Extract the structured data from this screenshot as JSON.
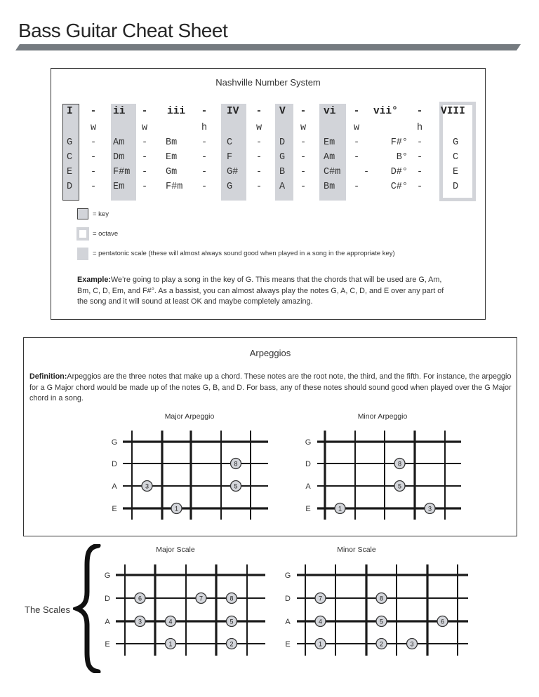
{
  "header": {
    "title": "Bass Guitar Cheat Sheet",
    "bar_color": "#757b80"
  },
  "nashville": {
    "title": "Nashville Number System",
    "numerals": [
      "I",
      "ii",
      "iii",
      "IV",
      "V",
      "vi",
      "vii°",
      "VIII"
    ],
    "separator": "-",
    "steps": [
      "w",
      "w",
      "h",
      "w",
      "w",
      "w",
      "h"
    ],
    "keys": [
      {
        "chords": [
          "G",
          "Am",
          "Bm",
          "C",
          "D",
          "Em",
          "F#°",
          "G"
        ]
      },
      {
        "chords": [
          "C",
          "Dm",
          "Em",
          "F",
          "G",
          "Am",
          "B°",
          "C"
        ]
      },
      {
        "chords": [
          "E",
          "F#m",
          "Gm",
          "G#",
          "B",
          "C#m",
          "D#°",
          "E"
        ]
      },
      {
        "chords": [
          "D",
          "Em",
          "F#m",
          "G",
          "A",
          "Bm",
          "C#°",
          "D"
        ]
      }
    ],
    "key_column": "I",
    "octave_column": "VIII",
    "pentatonic_columns": [
      "I",
      "ii",
      "IV",
      "V",
      "vi"
    ],
    "legend": [
      {
        "type": "key",
        "label": "= key"
      },
      {
        "type": "octave",
        "label": "= octave"
      },
      {
        "type": "pentatonic",
        "label": "= pentatonic scale (these will almost always sound good when played in a song in the appropriate key)"
      }
    ],
    "example_label": "Example:",
    "example_text": "We’re going to play a song in the key of G.  This means that the chords that will be used are G, Am, Bm, C, D, Em, and F#°.  As a bassist, you can almost always play the notes G, A, C, D, and E over any part of the song and it will sound at least OK and maybe completely amazing.",
    "highlight_color": "#d2d4d9"
  },
  "arpeggios": {
    "title": "Arpeggios",
    "definition_label": "Definition:",
    "definition_text": "Arpeggios are the three notes that make up a chord.  These notes are the root note, the third, and the fifth. For instance, the arpeggio for a G Major chord would be made up of the notes G, B, and D.  For bass, any of these notes should sound good when played over the G Major chord in a song.",
    "diagrams": [
      {
        "title": "Major Arpeggio",
        "strings": [
          "G",
          "D",
          "A",
          "E"
        ],
        "frets": 4,
        "notes": [
          {
            "string": "E",
            "fret": 2,
            "label": "1"
          },
          {
            "string": "A",
            "fret": 1,
            "label": "3"
          },
          {
            "string": "A",
            "fret": 4,
            "label": "5"
          },
          {
            "string": "D",
            "fret": 4,
            "label": "8"
          }
        ]
      },
      {
        "title": "Minor Arpeggio",
        "strings": [
          "G",
          "D",
          "A",
          "E"
        ],
        "frets": 4,
        "notes": [
          {
            "string": "E",
            "fret": 1,
            "label": "1"
          },
          {
            "string": "E",
            "fret": 4,
            "label": "3"
          },
          {
            "string": "A",
            "fret": 3,
            "label": "5"
          },
          {
            "string": "D",
            "fret": 3,
            "label": "8"
          }
        ]
      }
    ]
  },
  "scales": {
    "label": "The Scales",
    "diagrams": [
      {
        "title": "Major Scale",
        "strings": [
          "G",
          "D",
          "A",
          "E"
        ],
        "frets": 4,
        "notes": [
          {
            "string": "E",
            "fret": 2,
            "label": "1"
          },
          {
            "string": "E",
            "fret": 4,
            "label": "2"
          },
          {
            "string": "A",
            "fret": 1,
            "label": "3"
          },
          {
            "string": "A",
            "fret": 2,
            "label": "4"
          },
          {
            "string": "A",
            "fret": 4,
            "label": "5"
          },
          {
            "string": "D",
            "fret": 1,
            "label": "6"
          },
          {
            "string": "D",
            "fret": 3,
            "label": "7"
          },
          {
            "string": "D",
            "fret": 4,
            "label": "8"
          }
        ]
      },
      {
        "title": "Minor Scale",
        "strings": [
          "G",
          "D",
          "A",
          "E"
        ],
        "frets": 5,
        "notes": [
          {
            "string": "E",
            "fret": 1,
            "label": "1"
          },
          {
            "string": "E",
            "fret": 3,
            "label": "2"
          },
          {
            "string": "E",
            "fret": 4,
            "label": "3"
          },
          {
            "string": "A",
            "fret": 1,
            "label": "4"
          },
          {
            "string": "A",
            "fret": 3,
            "label": "5"
          },
          {
            "string": "A",
            "fret": 5,
            "label": "6"
          },
          {
            "string": "D",
            "fret": 1,
            "label": "7"
          },
          {
            "string": "D",
            "fret": 3,
            "label": "8"
          }
        ]
      }
    ]
  }
}
